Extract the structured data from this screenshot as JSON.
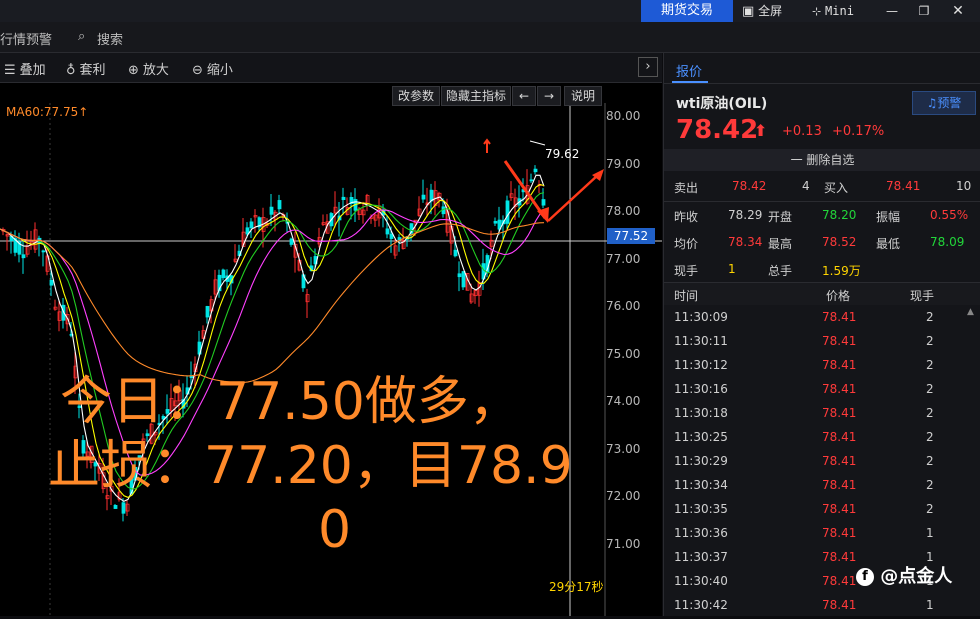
{
  "titlebar": {
    "trade_label": "期货交易",
    "fullscreen_label": "全屏",
    "mini_label": "Mini"
  },
  "nav": {
    "items": [
      "行情预警",
      "搜索"
    ]
  },
  "toolbar": {
    "items": [
      "叠加",
      "套利",
      "放大",
      "缩小"
    ]
  },
  "chart_controls": {
    "change_params": "改参数",
    "hide_indicator": "隐藏主指标",
    "explain": "说明"
  },
  "chart": {
    "ma_label": "MA60:77.75",
    "ma_arrow": "↑",
    "high_label": "79.62",
    "current_price_tag": "77.52",
    "timer": "29分17秒",
    "y_ticks": [
      "80.00",
      "79.00",
      "78.00",
      "77.00",
      "76.00",
      "75.00",
      "74.00",
      "73.00",
      "72.00",
      "71.00"
    ],
    "overlay_line1": "今日：77.50做多，",
    "overlay_line2": "止损：77.20，目78.9",
    "overlay_line3": "0",
    "colors": {
      "up": "#ff3030",
      "down": "#00e5e5",
      "ma_white": "#ffffff",
      "ma_yellow": "#ffff00",
      "ma_green": "#22cc22",
      "ma_magenta": "#ff40ff",
      "ma_blue": "#3050ff",
      "ma_orange": "#ff8a2a"
    }
  },
  "panel": {
    "tab_label": "报价",
    "symbol": "wti原油(OIL)",
    "alert_label": "预警",
    "price": "78.42",
    "change": "+0.13",
    "change_pct": "+0.17%",
    "remove_fav": "一 删除自选",
    "sell_label": "卖出",
    "sell_price": "78.42",
    "sell_qty": "4",
    "buy_label": "买入",
    "buy_price": "78.41",
    "buy_qty": "10",
    "stats": [
      {
        "label": "昨收",
        "value": "78.29",
        "cls": "lbl"
      },
      {
        "label": "开盘",
        "value": "78.20",
        "cls": "green"
      },
      {
        "label": "振幅",
        "value": "0.55%",
        "cls": "red"
      },
      {
        "label": "均价",
        "value": "78.34",
        "cls": "red"
      },
      {
        "label": "最高",
        "value": "78.52",
        "cls": "red"
      },
      {
        "label": "最低",
        "value": "78.09",
        "cls": "green"
      },
      {
        "label": "现手",
        "value": "1",
        "cls": "yellow"
      },
      {
        "label": "总手",
        "value": "1.59万",
        "cls": "yellow"
      }
    ],
    "trade_headers": [
      "时间",
      "价格",
      "现手"
    ],
    "trades": [
      {
        "time": "11:30:09",
        "price": "78.41",
        "qty": "2"
      },
      {
        "time": "11:30:11",
        "price": "78.41",
        "qty": "2"
      },
      {
        "time": "11:30:12",
        "price": "78.41",
        "qty": "2"
      },
      {
        "time": "11:30:16",
        "price": "78.41",
        "qty": "2"
      },
      {
        "time": "11:30:18",
        "price": "78.41",
        "qty": "2"
      },
      {
        "time": "11:30:25",
        "price": "78.41",
        "qty": "2"
      },
      {
        "time": "11:30:29",
        "price": "78.41",
        "qty": "2"
      },
      {
        "time": "11:30:34",
        "price": "78.41",
        "qty": "2"
      },
      {
        "time": "11:30:35",
        "price": "78.41",
        "qty": "2"
      },
      {
        "time": "11:30:36",
        "price": "78.41",
        "qty": "1"
      },
      {
        "time": "11:30:37",
        "price": "78.41",
        "qty": "1"
      },
      {
        "time": "11:30:40",
        "price": "78.41",
        "qty": "1"
      },
      {
        "time": "11:30:42",
        "price": "78.41",
        "qty": "1"
      }
    ]
  },
  "watermark": "@点金人"
}
